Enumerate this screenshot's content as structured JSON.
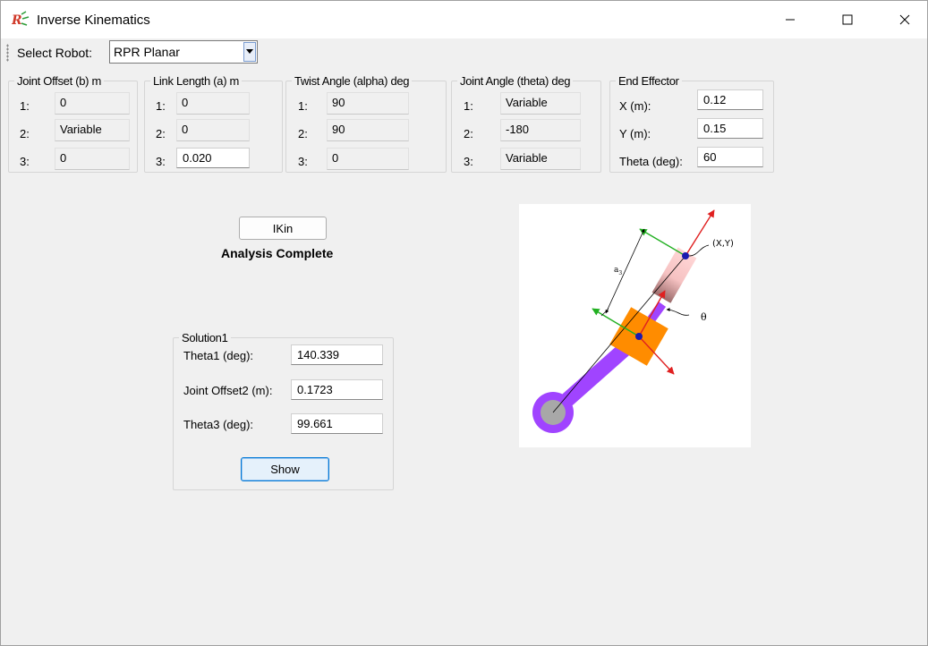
{
  "window": {
    "title": "Inverse Kinematics"
  },
  "toolbar": {
    "select_label": "Select Robot:",
    "robot_value": "RPR Planar"
  },
  "groups": {
    "joint_offset": {
      "title": "Joint Offset (b) m",
      "rows": [
        {
          "index": "1:",
          "value": "0"
        },
        {
          "index": "2:",
          "value": "Variable"
        },
        {
          "index": "3:",
          "value": "0"
        }
      ]
    },
    "link_length": {
      "title": "Link Length (a) m",
      "rows": [
        {
          "index": "1:",
          "value": "0"
        },
        {
          "index": "2:",
          "value": "0"
        },
        {
          "index": "3:",
          "value": "0.020"
        }
      ]
    },
    "twist_angle": {
      "title": "Twist Angle (alpha) deg",
      "rows": [
        {
          "index": "1:",
          "value": "90"
        },
        {
          "index": "2:",
          "value": "90"
        },
        {
          "index": "3:",
          "value": "0"
        }
      ]
    },
    "joint_angle": {
      "title": "Joint Angle (theta) deg",
      "rows": [
        {
          "index": "1:",
          "value": "Variable"
        },
        {
          "index": "2:",
          "value": "-180"
        },
        {
          "index": "3:",
          "value": "Variable"
        }
      ]
    },
    "end_effector": {
      "title": "End Effector",
      "rows": [
        {
          "label": "X (m):",
          "value": "0.12"
        },
        {
          "label": "Y (m):",
          "value": "0.15"
        },
        {
          "label": "Theta (deg):",
          "value": "60"
        }
      ]
    }
  },
  "actions": {
    "ikin_label": "IKin",
    "status": "Analysis Complete"
  },
  "solution": {
    "title": "Solution1",
    "rows": [
      {
        "label": "Theta1 (deg):",
        "value": "140.339"
      },
      {
        "label": "Joint Offset2 (m):",
        "value": "0.1723"
      },
      {
        "label": "Theta3 (deg):",
        "value": "99.661"
      }
    ],
    "show_label": "Show"
  },
  "diagram": {
    "label_xy": "(X,Y)",
    "label_theta": "θ",
    "label_a3": "a",
    "label_a3_sub": "3"
  },
  "colors": {
    "accent": "#0078d7",
    "link_purple": "#a044ff",
    "block_orange": "#ff8c00",
    "link_pink": "#f4b8b8"
  }
}
